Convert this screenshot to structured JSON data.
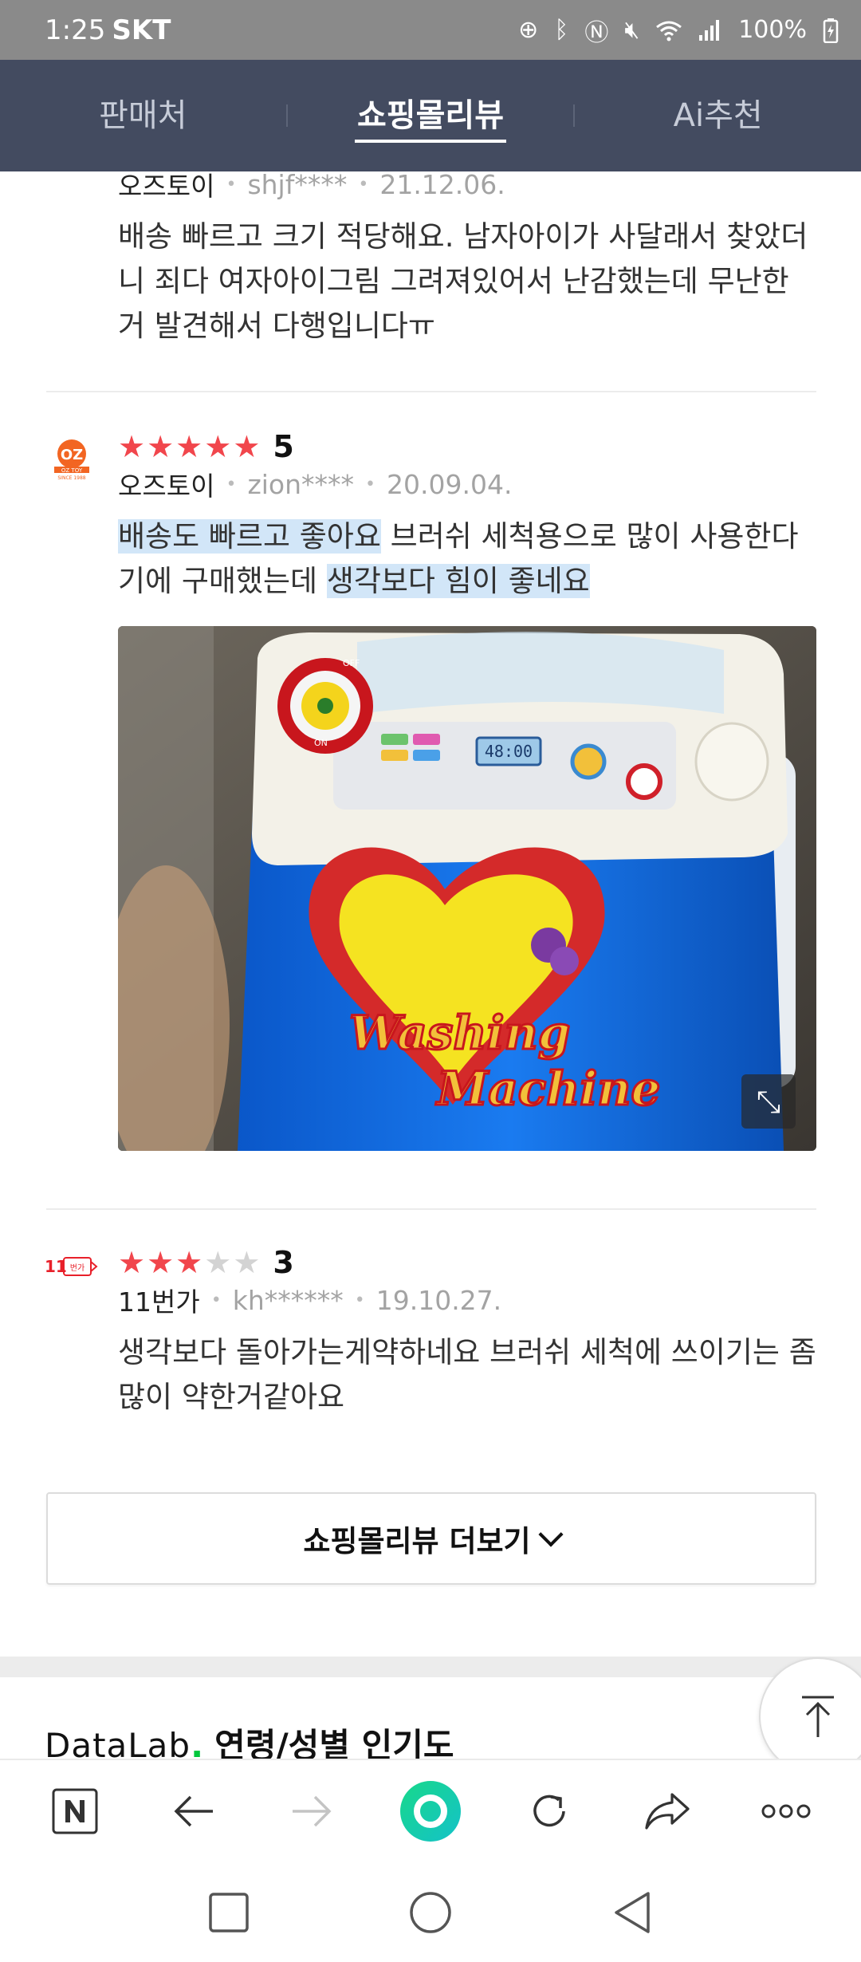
{
  "status_bar": {
    "time": "1:25",
    "carrier": "SKT",
    "battery": "100%",
    "icons": [
      "sync-icon",
      "bluetooth-icon",
      "nfc-icon",
      "mute-icon",
      "wifi-icon",
      "signal-icon",
      "battery-icon"
    ]
  },
  "tabs": [
    {
      "label": "판매처",
      "active": false
    },
    {
      "label": "쇼핑몰리뷰",
      "active": true
    },
    {
      "label": "Ai추천",
      "active": false
    }
  ],
  "reviews": [
    {
      "shop": "오즈토이",
      "user": "shjf****",
      "date": "21.12.06.",
      "text": "배송 빠르고 크기 적당해요. 남자아이가 사달래서 찾았더니 죄다 여자아이그림 그려져있어서 난감했는데 무난한 거 발견해서 다행입니다ㅠ"
    },
    {
      "shop": "오즈토이",
      "shop_logo": "OZ TOY",
      "shop_logo_sub": "SINCE 1988",
      "rating": 5,
      "user": "zion****",
      "date": "20.09.04.",
      "text_hl1": "배송도 빠르고 좋아요",
      "text_mid": " 브러쉬 세척용으로 많이 사용한다기에 구매했는데 ",
      "text_hl2": "생각보다 힘이 좋네요",
      "photo": {
        "display": "48:00",
        "label_off": "OFF",
        "label_on": "ON",
        "brand_line1": "Washing",
        "brand_line2": "Machine"
      }
    },
    {
      "shop": "11번가",
      "shop_logo": "11번가",
      "rating": 3,
      "user": "kh******",
      "date": "19.10.27.",
      "text": "생각보다 돌아가는게약하네요 브러쉬 세척에 쓰이기는 좀 많이 약한거같아요"
    }
  ],
  "more_button": "쇼핑몰리뷰 더보기",
  "datalab": {
    "brand": "DataLab",
    "dot": ".",
    "title": "연령/성별 인기도"
  },
  "colors": {
    "header_bg": "#434b60",
    "star": "#f1464c",
    "highlight": "#d2e6f8",
    "naver_green": "#00c73c"
  }
}
